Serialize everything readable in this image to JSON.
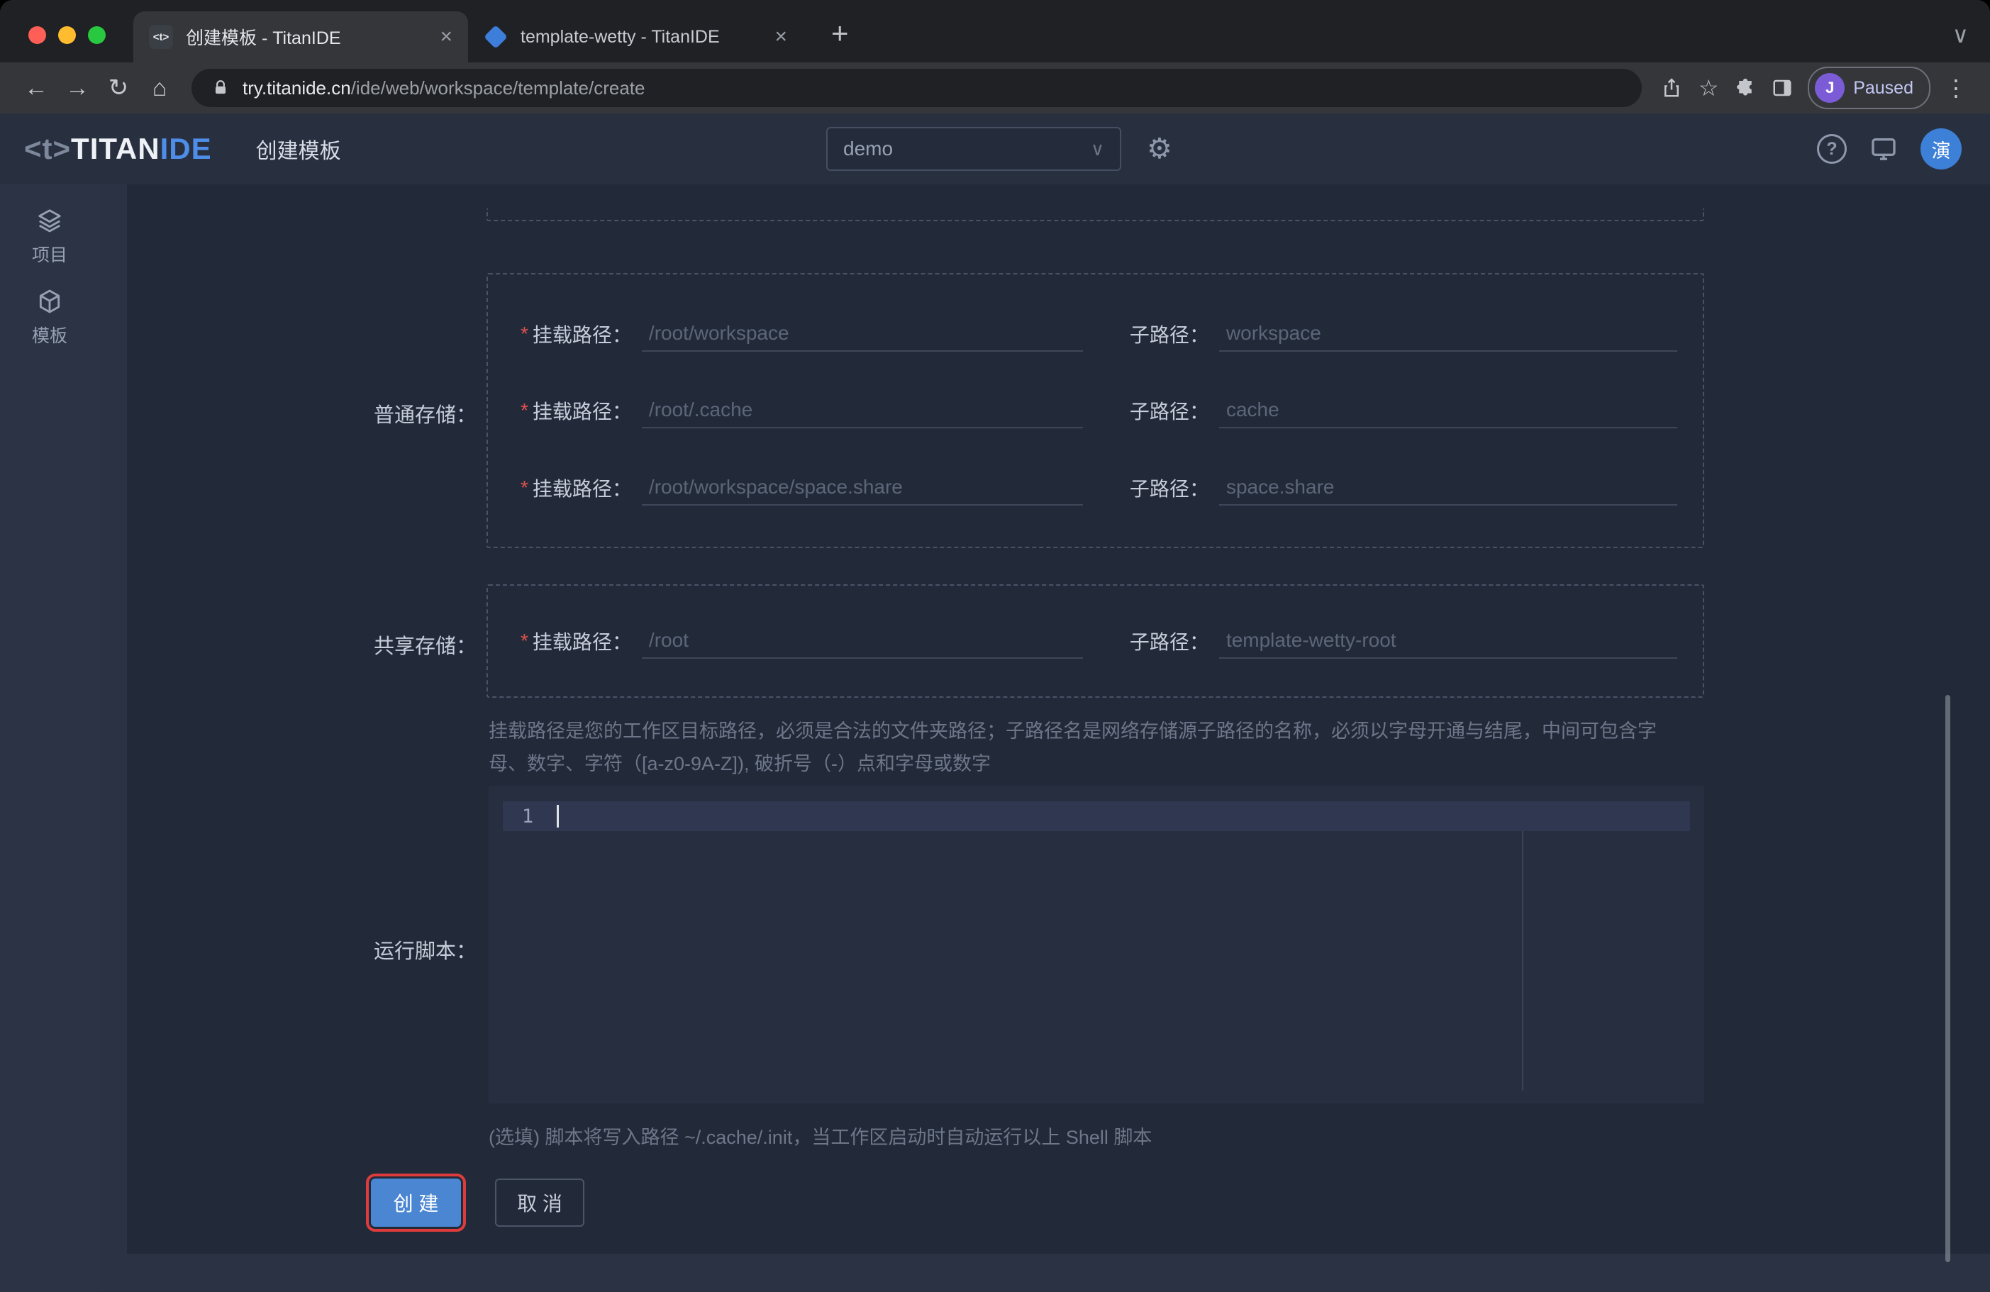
{
  "icons": {
    "back": "←",
    "forward": "→",
    "reload": "↻",
    "home": "⌂",
    "close": "×",
    "new_tab": "+",
    "menu_dots": "⋮",
    "star": "☆",
    "gear": "⚙",
    "select_chevron": "∨",
    "strip_chevron": "∨",
    "help": "?"
  },
  "browser": {
    "tabs": [
      {
        "title": "创建模板 - TitanIDE",
        "favicon_text": "<t>"
      },
      {
        "title": "template-wetty - TitanIDE"
      }
    ],
    "url_domain": "try.titanide.cn",
    "url_path": "/ide/web/workspace/template/create",
    "profile_initial": "J",
    "profile_status": "Paused"
  },
  "app_header": {
    "logo_bracket": "<t>",
    "logo_titan": "TITAN",
    "logo_ide": "IDE",
    "page_title": "创建模板",
    "workspace_select_value": "demo",
    "avatar_text": "演"
  },
  "sidebar": {
    "items": [
      {
        "label": "项目"
      },
      {
        "label": "模板"
      }
    ]
  },
  "form": {
    "required_marker": "*",
    "normal_storage_label": "普通存储：",
    "normal_rows": [
      {
        "mount_label": "挂载路径：",
        "mount_value": "/root/workspace",
        "sub_label": "子路径：",
        "sub_value": "workspace"
      },
      {
        "mount_label": "挂载路径：",
        "mount_value": "/root/.cache",
        "sub_label": "子路径：",
        "sub_value": "cache"
      },
      {
        "mount_label": "挂载路径：",
        "mount_value": "/root/workspace/space.share",
        "sub_label": "子路径：",
        "sub_value": "space.share"
      }
    ],
    "shared_storage_label": "共享存储：",
    "shared_row": {
      "mount_label": "挂载路径：",
      "mount_value": "/root",
      "sub_label": "子路径：",
      "sub_value": "template-wetty-root"
    },
    "path_hint": "挂载路径是您的工作区目标路径，必须是合法的文件夹路径；子路径名是网络存储源子路径的名称，必须以字母开通与结尾，中间可包含字母、数字、字符（[a-z0-9A-Z]), 破折号（-）点和字母或数字",
    "script_label": "运行脚本：",
    "script_line_number": "1",
    "script_hint": "(选填) 脚本将写入路径 ~/.cache/.init，当工作区启动时自动运行以上 Shell 脚本",
    "create_button": "创 建",
    "cancel_button": "取 消"
  }
}
